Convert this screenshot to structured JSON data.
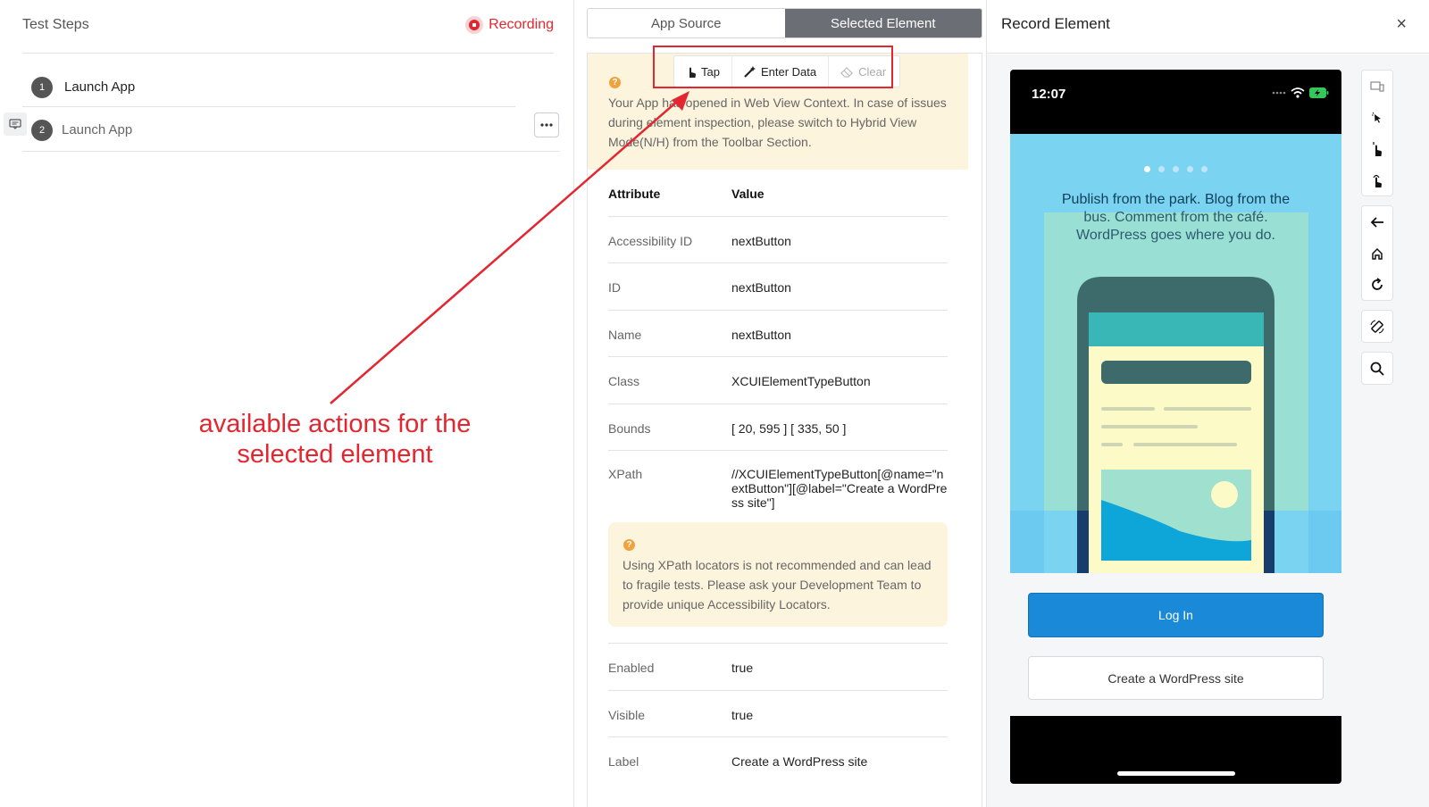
{
  "left": {
    "title": "Test Steps",
    "recording_label": "Recording",
    "steps": [
      {
        "num": "1",
        "label": "Launch App"
      },
      {
        "num": "2",
        "label": "Launch App"
      }
    ],
    "annotation": {
      "line1": "available actions for the",
      "line2": "selected element"
    }
  },
  "middle": {
    "tabs": [
      {
        "label": "App Source"
      },
      {
        "label": "Selected Element"
      }
    ],
    "notice": {
      "line1": "Your App has opened in Web View Context. In case of issues",
      "line2": "during element inspection, please switch to Hybrid View",
      "line3": "Mode(N/H) from the Toolbar Section."
    },
    "actions": {
      "tap": "Tap",
      "enter_data": "Enter Data",
      "clear": "Clear"
    },
    "table_header": {
      "attribute": "Attribute",
      "value": "Value"
    },
    "attributes": [
      {
        "key": "Accessibility ID",
        "value": "nextButton"
      },
      {
        "key": "ID",
        "value": "nextButton"
      },
      {
        "key": "Name",
        "value": "nextButton"
      },
      {
        "key": "Class",
        "value": "XCUIElementTypeButton"
      },
      {
        "key": "Bounds",
        "value": "[ 20, 595 ] [ 335, 50 ]"
      },
      {
        "key": "XPath",
        "value": "//XCUIElementTypeButton[@name=\"nextButton\"][@label=\"Create a WordPress site\"]"
      }
    ],
    "xpath_warning": {
      "line1": "Using XPath locators is not recommended and can lead",
      "line2": "to fragile tests. Please ask your Development Team to",
      "line3": "provide unique Accessibility Locators."
    },
    "attributes2": [
      {
        "key": "Enabled",
        "value": "true"
      },
      {
        "key": "Visible",
        "value": "true"
      },
      {
        "key": "Label",
        "value": "Create a WordPress site"
      }
    ]
  },
  "right": {
    "title": "Record Element",
    "close": "×",
    "device": {
      "time": "12:07",
      "hero_line1": "Publish from the park. Blog from the",
      "hero_line2": "bus. Comment from the café.",
      "hero_line3": "WordPress goes where you do.",
      "login": "Log In",
      "create": "Create a WordPress site"
    },
    "toolbar_icons": [
      "device-icon",
      "pointer-icon",
      "tap-icon",
      "swipe-icon",
      "back-icon",
      "home-icon",
      "refresh-icon",
      "rotate-icon",
      "search-icon"
    ]
  },
  "colors": {
    "accent_red": "#e3262f",
    "notice_bg": "#fdf4dd",
    "active_tab": "#6b6f75",
    "login_blue": "#1a8ad8",
    "hero_bg": "#7bd3f2"
  }
}
